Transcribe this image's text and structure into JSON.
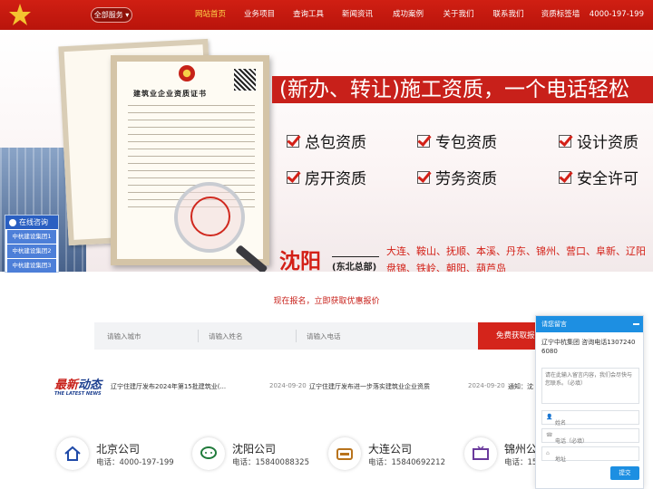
{
  "header": {
    "region_button": "全部服务",
    "nav": [
      {
        "label": "网站首页",
        "active": true
      },
      {
        "label": "业务项目",
        "active": false
      },
      {
        "label": "查询工具",
        "active": false
      },
      {
        "label": "新闻资讯",
        "active": false
      },
      {
        "label": "成功案例",
        "active": false
      },
      {
        "label": "关于我们",
        "active": false
      },
      {
        "label": "联系我们",
        "active": false
      },
      {
        "label": "资质标签墙",
        "active": false
      }
    ],
    "hotline": "4000-197-199"
  },
  "banner": {
    "certificate_title": "建筑业企业资质证书",
    "headline": "(新办、转让)施工资质，一个电话轻松",
    "services": [
      "总包资质",
      "专包资质",
      "设计资质",
      "房开资质",
      "劳务资质",
      "安全许可"
    ],
    "city": "沈阳",
    "hq": "(东北总部)",
    "cities_line1": "大连、鞍山、抚顺、本溪、丹东、锦州、营口、阜新、辽阳",
    "cities_line2": "盘锦、铁岭、朝阳、葫芦岛"
  },
  "float_left": {
    "title": "在线咨询",
    "items": [
      "中杭建设集团1",
      "中杭建设集团2",
      "中杭建设集团3"
    ]
  },
  "signup": {
    "title": "现在报名，立即获取优惠报价",
    "city_placeholder": "请输入城市",
    "name_placeholder": "请输入姓名",
    "phone_placeholder": "请输入电话",
    "button": "免费获取报价"
  },
  "news": {
    "logo_cn_a": "最新",
    "logo_cn_b": "动态",
    "logo_en": "THE LATEST NEWS",
    "items": [
      {
        "title": "辽宁住建厅发布2024年第15批建筑业(...",
        "date": "2024-09-20"
      },
      {
        "title": "辽宁住建厅发布进一步落实建筑业企业资质",
        "date": "2024-09-20"
      },
      {
        "title": "通知：沈"
      }
    ]
  },
  "offices": [
    {
      "name": "北京公司",
      "tel": "电话：4000-197-199",
      "icon": "house-icon"
    },
    {
      "name": "沈阳公司",
      "tel": "电话：15840088325",
      "icon": "chat-icon"
    },
    {
      "name": "大连公司",
      "tel": "电话：15840692212",
      "icon": "wallet-icon"
    },
    {
      "name": "锦州公",
      "tel": "电话：15",
      "icon": "tv-icon"
    }
  ],
  "message_panel": {
    "title": "请您留言",
    "intro": "辽宁中杭集团 咨询电话13072406080",
    "textarea_placeholder": "请在此输入留言内容，我们会尽快与您联系。（必填）",
    "name_placeholder": "姓名",
    "phone_placeholder": "电话（必填）",
    "address_placeholder": "地址",
    "submit": "提交"
  },
  "colors": {
    "brand_red": "#c8201a",
    "nav_active": "#ffd84a",
    "panel_blue": "#1d8fe2",
    "float_blue": "#2a5fc2"
  }
}
